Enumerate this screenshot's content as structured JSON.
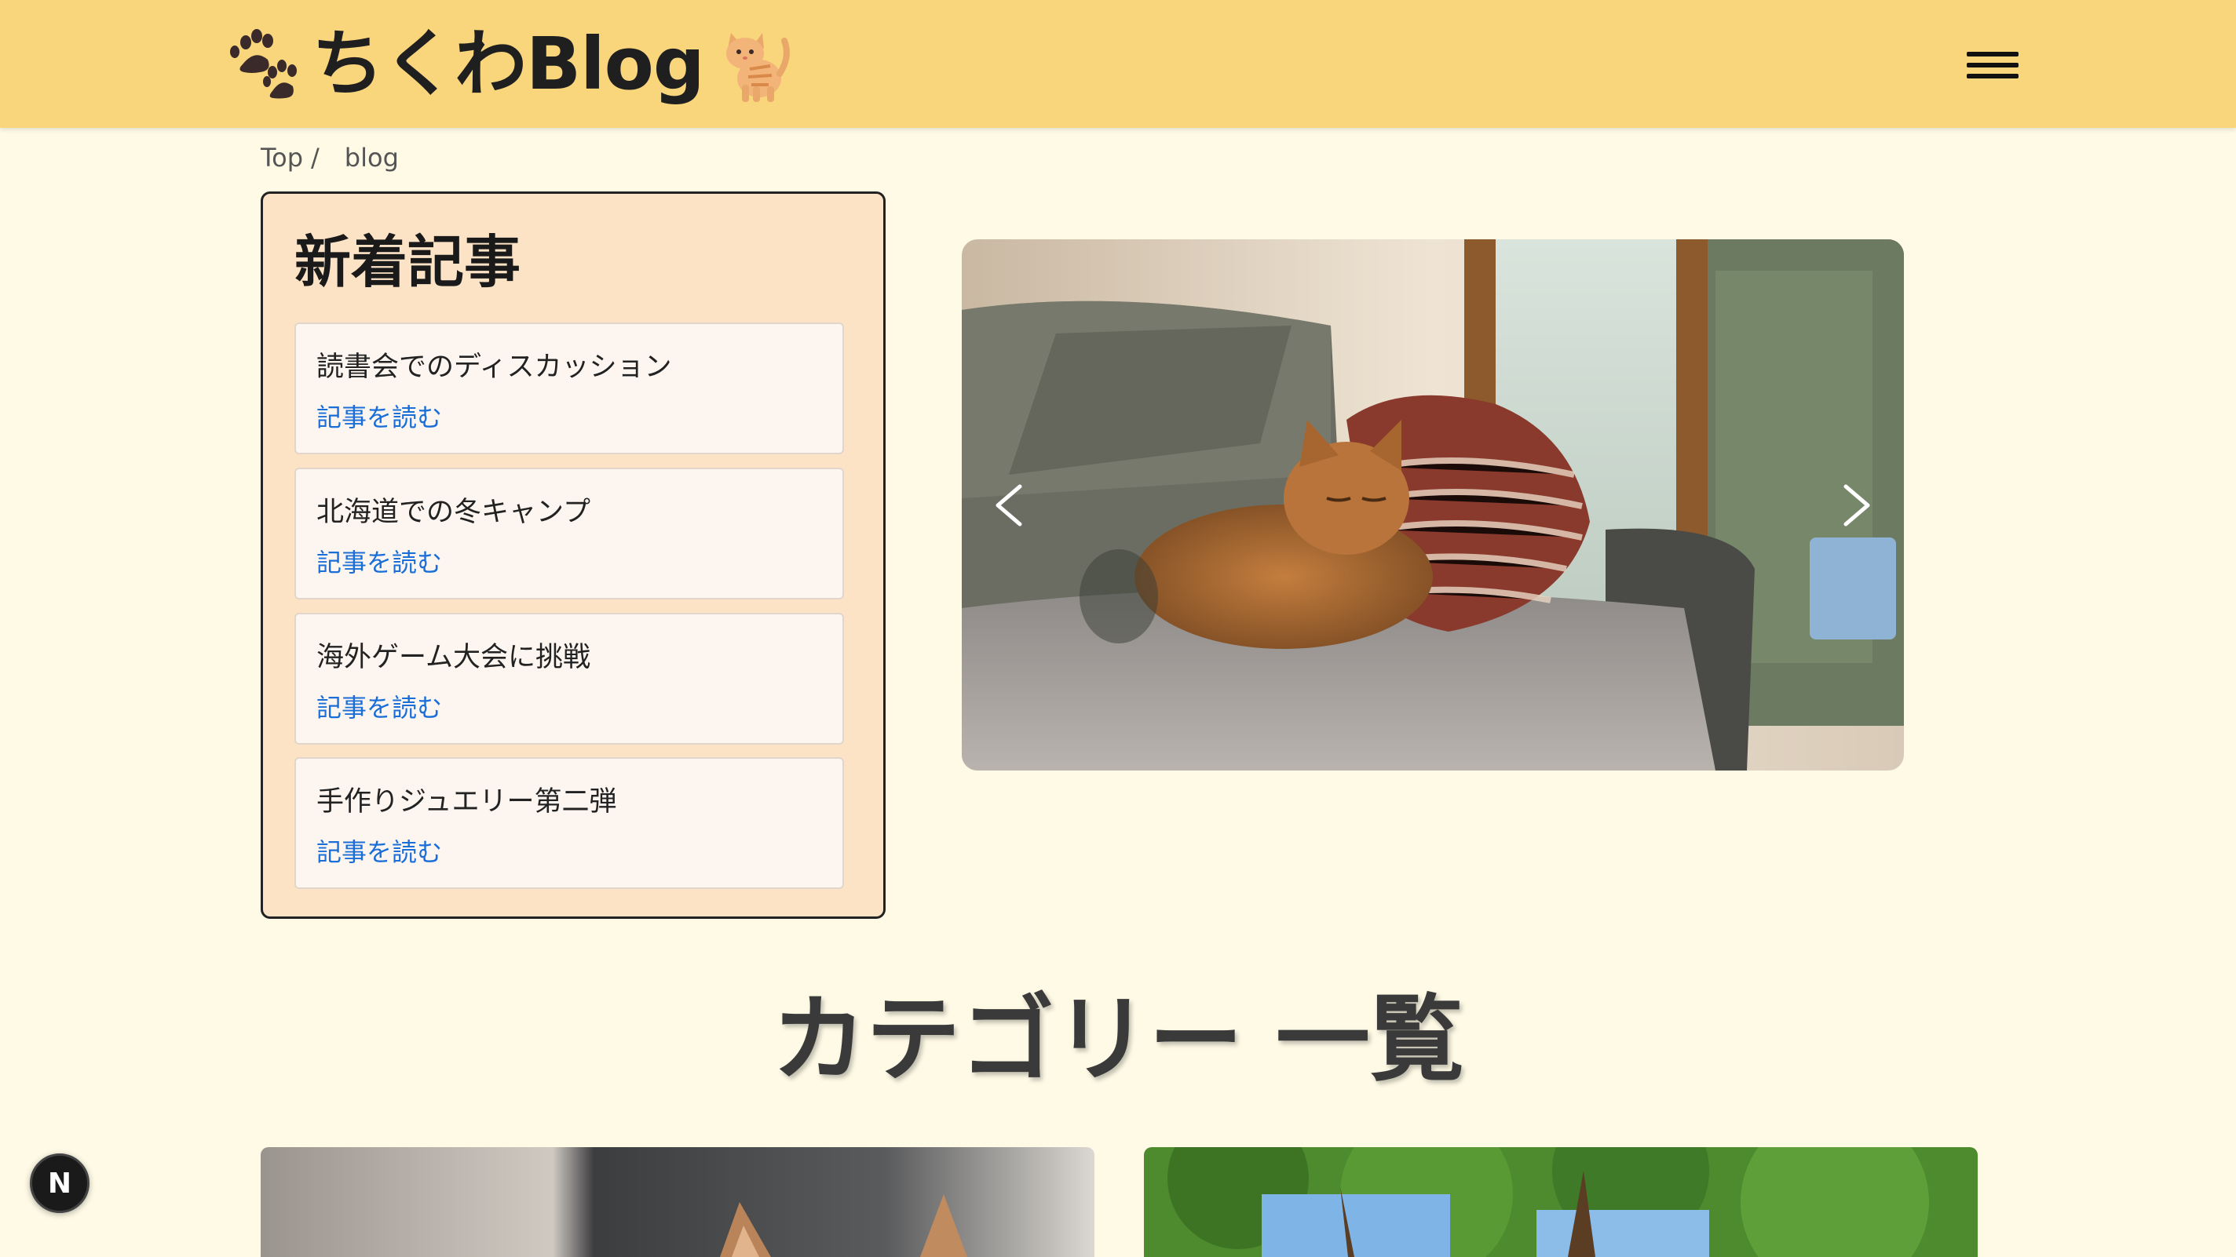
{
  "header": {
    "title": "ちくわBlog",
    "paw_icon": "paw-prints-icon",
    "cat_icon": "cat-icon",
    "menu_icon": "hamburger-menu-icon",
    "background": "#f9d57c"
  },
  "breadcrumb": {
    "items": [
      "Top",
      "blog"
    ],
    "separator": "/"
  },
  "new_articles": {
    "heading": "新着記事",
    "items": [
      {
        "title": "読書会でのディスカッション",
        "link": "記事を読む"
      },
      {
        "title": "北海道での冬キャンプ",
        "link": "記事を読む"
      },
      {
        "title": "海外ゲーム大会に挑戦",
        "link": "記事を読む"
      },
      {
        "title": "手作りジュエリー第二弾",
        "link": "記事を読む"
      }
    ],
    "panel_color": "#fde3c6",
    "link_color": "#1a6ed8"
  },
  "carousel": {
    "prev_icon": "chevron-left-icon",
    "next_icon": "chevron-right-icon",
    "image": "cat-on-sofa-photo"
  },
  "categories": {
    "heading": "カテゴリー 一覧",
    "cards": [
      {
        "image": "cat-ears-photo"
      },
      {
        "image": "trees-photo"
      }
    ]
  },
  "dev_badge": {
    "label": "N"
  }
}
